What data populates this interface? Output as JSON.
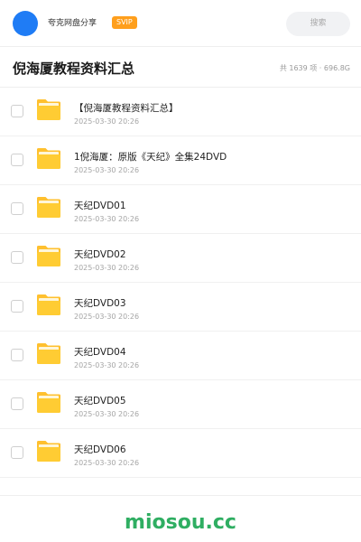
{
  "colors": {
    "avatar": "#1f7cf5",
    "svip": "#ff9f1c",
    "folder_back": "#ffc02e",
    "folder_front": "#ffcc33",
    "folder_paper": "#fff6d8",
    "watermark": "#2fae62"
  },
  "topbar": {
    "user_name": "夸克网盘分享",
    "badge": "SVIP",
    "search_label": "搜索"
  },
  "header": {
    "title": "倪海厦教程资料汇总",
    "meta": "共 1639 项 · 696.8G"
  },
  "files": [
    {
      "name": "【倪海厦教程资料汇总】",
      "date": "2025-03-30 20:26",
      "icon": "folder-icon"
    },
    {
      "name": "1倪海厦：原版《天纪》全集24DVD",
      "date": "2025-03-30 20:26",
      "icon": "folder-icon"
    },
    {
      "name": "天纪DVD01",
      "date": "2025-03-30 20:26",
      "icon": "folder-icon"
    },
    {
      "name": "天纪DVD02",
      "date": "2025-03-30 20:26",
      "icon": "folder-icon"
    },
    {
      "name": "天纪DVD03",
      "date": "2025-03-30 20:26",
      "icon": "folder-icon"
    },
    {
      "name": "天纪DVD04",
      "date": "2025-03-30 20:26",
      "icon": "folder-icon"
    },
    {
      "name": "天纪DVD05",
      "date": "2025-03-30 20:26",
      "icon": "folder-icon"
    },
    {
      "name": "天纪DVD06",
      "date": "2025-03-30 20:26",
      "icon": "folder-icon"
    }
  ],
  "footer": {
    "watermark": "miosou.cc"
  }
}
